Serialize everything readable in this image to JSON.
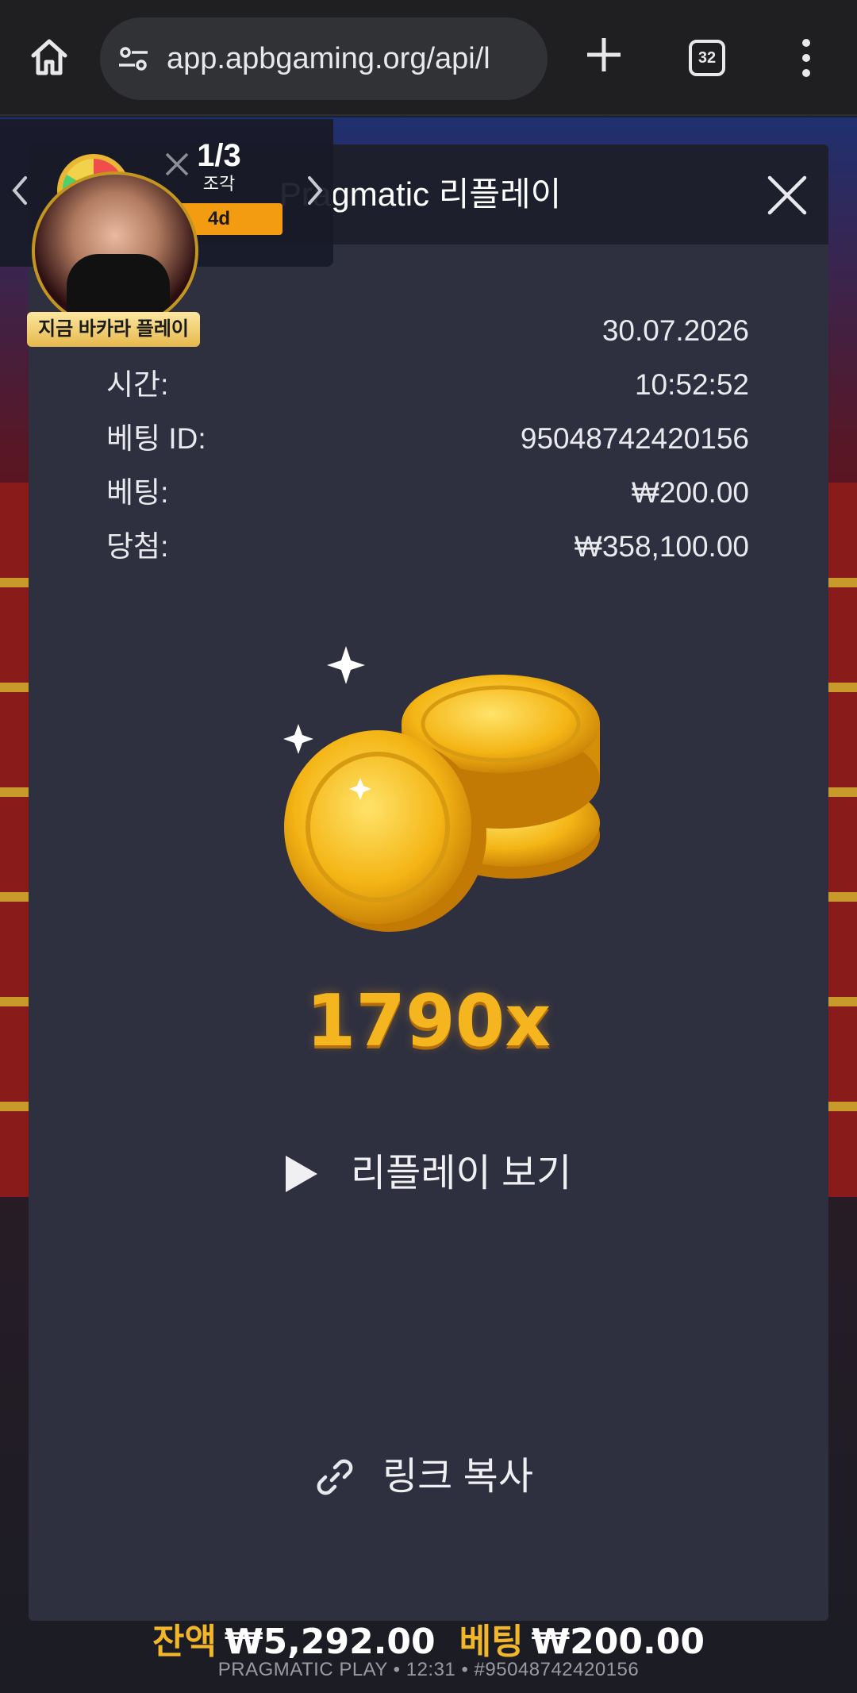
{
  "browser": {
    "url": "app.apbgaming.org/api/l",
    "tab_count": "32"
  },
  "modal": {
    "title": "Pragmatic 리플레이",
    "rows": [
      {
        "label": "",
        "value": "30.07.2026"
      },
      {
        "label": "시간:",
        "value": "10:52:52"
      },
      {
        "label": "베팅 ID:",
        "value": "95048742420156"
      },
      {
        "label": "베팅:",
        "value": "₩200.00"
      },
      {
        "label": "당첨:",
        "value": "₩358,100.00"
      }
    ],
    "multiplier": "1790x",
    "replay_label": "리플레이 보기",
    "copy_label": "링크 복사"
  },
  "promo": {
    "count": "1/3",
    "sub": "조각",
    "badge": "4d",
    "dealer_label": "지금 바카라 플레이"
  },
  "game": {
    "balance_label": "잔액",
    "balance_value": "₩5,292.00",
    "bet_label": "베팅",
    "bet_value": "₩200.00",
    "footer": "PRAGMATIC PLAY • 12:31 • #95048742420156"
  },
  "colors": {
    "accent_gold": "#f5b51f",
    "modal_bg": "#2e3040",
    "header_bg": "#1d1f2d",
    "badge_orange": "#f39c12"
  }
}
